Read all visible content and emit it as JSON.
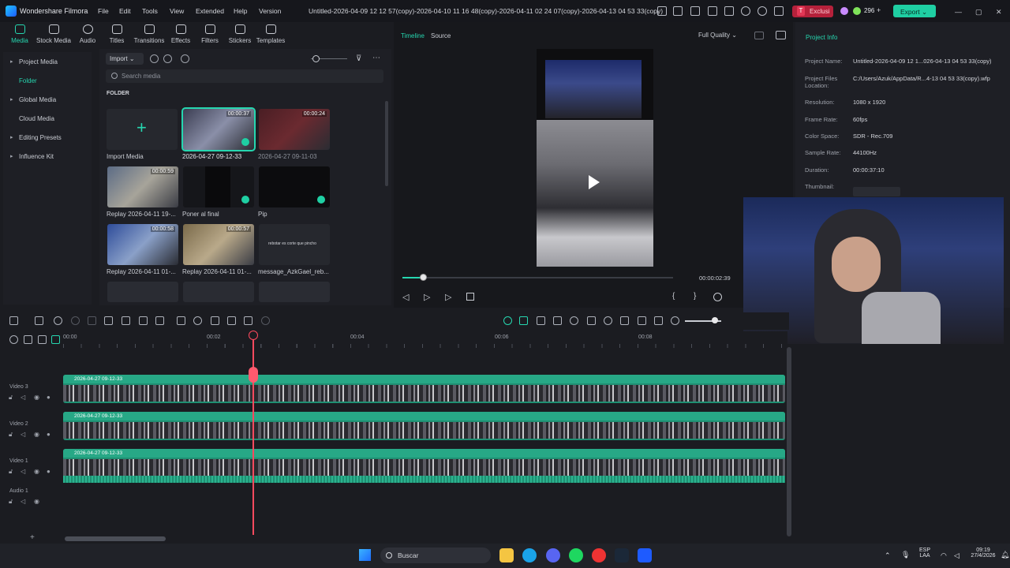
{
  "app": {
    "name": "Wondershare Filmora",
    "menu": [
      "File",
      "Edit",
      "Tools",
      "View",
      "Extended",
      "Help",
      "Version"
    ],
    "file_title": "Untitled-2026-04-09 12 12 57(copy)-2026-04-10 11 16 48(copy)-2026-04-11 02 24 07(copy)-2026-04-13 04 53 33(copy)",
    "exclusive_label": "Exclusi",
    "credits": "296",
    "export_label": "Export"
  },
  "toolbar": [
    "Media",
    "Stock Media",
    "Audio",
    "Titles",
    "Transitions",
    "Effects",
    "Filters",
    "Stickers",
    "Templates"
  ],
  "sidebar": [
    {
      "label": "Project Media"
    },
    {
      "label": "Folder"
    },
    {
      "label": "Global Media"
    },
    {
      "label": "Cloud Media"
    },
    {
      "label": "Editing Presets"
    },
    {
      "label": "Influence Kit"
    }
  ],
  "media": {
    "import_label": "Import",
    "search_placeholder": "Search media",
    "folder_label": "FOLDER",
    "import_media_label": "Import Media",
    "items": [
      {
        "name": "2026-04-27 09-12-33",
        "duration": "00:00:37"
      },
      {
        "name": "2026-04-27 09-11-03",
        "duration": "00:00:24"
      },
      {
        "name": "Replay 2026-04-11 19-...",
        "duration": "00:00:59"
      },
      {
        "name": "Poner al final",
        "duration": ""
      },
      {
        "name": "Pip",
        "duration": ""
      },
      {
        "name": "Replay 2026-04-11 01-...",
        "duration": "00:00:58"
      },
      {
        "name": "Replay 2026-04-11 01-...",
        "duration": "00:00:57"
      },
      {
        "name": "message_AzkGael_reb...",
        "duration": ""
      }
    ],
    "message_thumb_text": "rebotar es corte que pincho"
  },
  "preview": {
    "tab_timeline": "Timeline",
    "tab_source": "Source",
    "quality": "Full Quality",
    "time": "00:00:02:39"
  },
  "project_info": {
    "title": "Project Info",
    "rows": [
      {
        "label": "Project Name:",
        "value": "Untitled-2026-04-09 12 1...026-04-13 04 53 33(copy)"
      },
      {
        "label": "Project Files Location:",
        "value": "C:/Users/Azuk/AppData/R...4-13 04 53 33(copy).wfp"
      },
      {
        "label": "Resolution:",
        "value": "1080 x 1920"
      },
      {
        "label": "Frame Rate:",
        "value": "60fps"
      },
      {
        "label": "Color Space:",
        "value": "SDR - Rec.709"
      },
      {
        "label": "Sample Rate:",
        "value": "44100Hz"
      },
      {
        "label": "Duration:",
        "value": "00:00:37:10"
      },
      {
        "label": "Thumbnail:",
        "value": ""
      }
    ]
  },
  "timeline": {
    "ruler": [
      "00:00",
      "00:02",
      "00:04",
      "00:06",
      "00:08"
    ],
    "tracks": [
      {
        "label": "Video 3",
        "clip": "2026-04-27 09-12-33"
      },
      {
        "label": "Video 2",
        "clip": "2026-04-27 09-12-33"
      },
      {
        "label": "Video 1",
        "clip": "2026-04-27 09-12-33"
      },
      {
        "label": "Audio 1",
        "clip": ""
      }
    ]
  },
  "taskbar": {
    "search": "Buscar",
    "lang": "ESP",
    "region": "LAA",
    "time": "09:19",
    "date": "27/4/2026"
  }
}
